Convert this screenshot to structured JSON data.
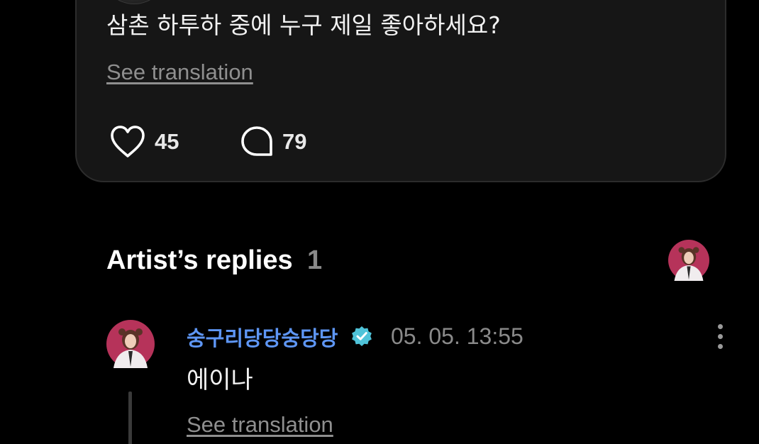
{
  "post": {
    "text": "삼촌 하투하 중에 누구 제일 좋아하세요?",
    "see_translation": "See translation",
    "likes": "45",
    "comments": "79"
  },
  "artist_replies": {
    "title": "Artist’s replies",
    "count": "1"
  },
  "reply": {
    "author": "숭구리당당숭당당",
    "timestamp": "05. 05. 13:55",
    "text": "에이나",
    "see_translation": "See translation"
  },
  "colors": {
    "background": "#000000",
    "card": "#161616",
    "author_link": "#5e96f5",
    "verified": "#4fc3d9",
    "muted_text": "#8a8a8a"
  },
  "icons": {
    "like": "heart-outline-icon",
    "comment": "speech-bubble-icon",
    "verified": "verified-badge-icon",
    "more": "more-vertical-icon"
  }
}
